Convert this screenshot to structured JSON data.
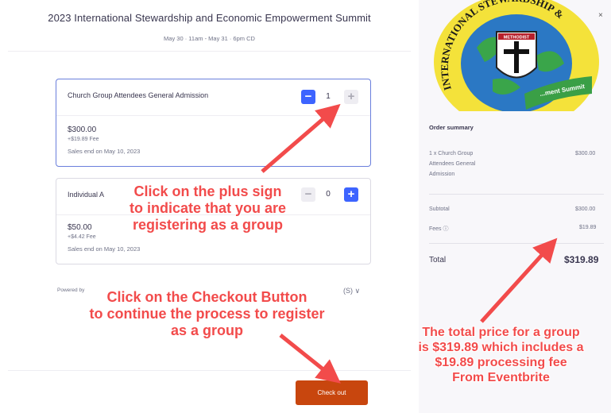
{
  "event": {
    "title": "2023 International Stewardship and Economic Empowerment Summit",
    "dates": "May 30 · 11am - May 31 · 6pm CD"
  },
  "tickets": [
    {
      "name": "Church Group Attendees General Admission",
      "price": "$300.00",
      "fee": "+$19.89 Fee",
      "sales_end": "Sales end on May 10, 2023",
      "quantity": "1"
    },
    {
      "name": "Individual A",
      "price": "$50.00",
      "fee": "+$4.42 Fee",
      "sales_end": "Sales end on May 10, 2023",
      "quantity": "0"
    }
  ],
  "powered_by": "Powered by",
  "currency_selector": "(S) ∨",
  "checkout_label": "Check out",
  "close_label": "×",
  "logo": {
    "ring_text": "INTERNATIONAL STEWARDSHIP &",
    "shield_text": "METHODIST",
    "banner_text": "...ment Summit"
  },
  "summary": {
    "title": "Order summary",
    "line_item_lines": [
      "1 x Church Group",
      "Attendees General",
      "Admission"
    ],
    "line_item_price": "$300.00",
    "subtotal_label": "Subtotal",
    "subtotal_value": "$300.00",
    "fees_label": "Fees ⓘ",
    "fees_value": "$19.89",
    "total_label": "Total",
    "total_value": "$319.89"
  },
  "callouts": {
    "plus": [
      "Click on the plus sign",
      "to indicate that you are",
      "registering as a group"
    ],
    "checkout": [
      "Click on the Checkout Button",
      "to continue the process to register",
      "as a group"
    ],
    "total": [
      "The total price for a group",
      "is $319.89 which includes a",
      "$19.89 processing fee",
      "From Eventbrite"
    ]
  },
  "icons": {
    "minus": "−",
    "plus": "+"
  },
  "colors": {
    "brand_orange": "#c8460e",
    "qty_blue": "#3d64ff",
    "annotation_red": "#f24b4b",
    "selected_border": "#6a7fdc"
  }
}
